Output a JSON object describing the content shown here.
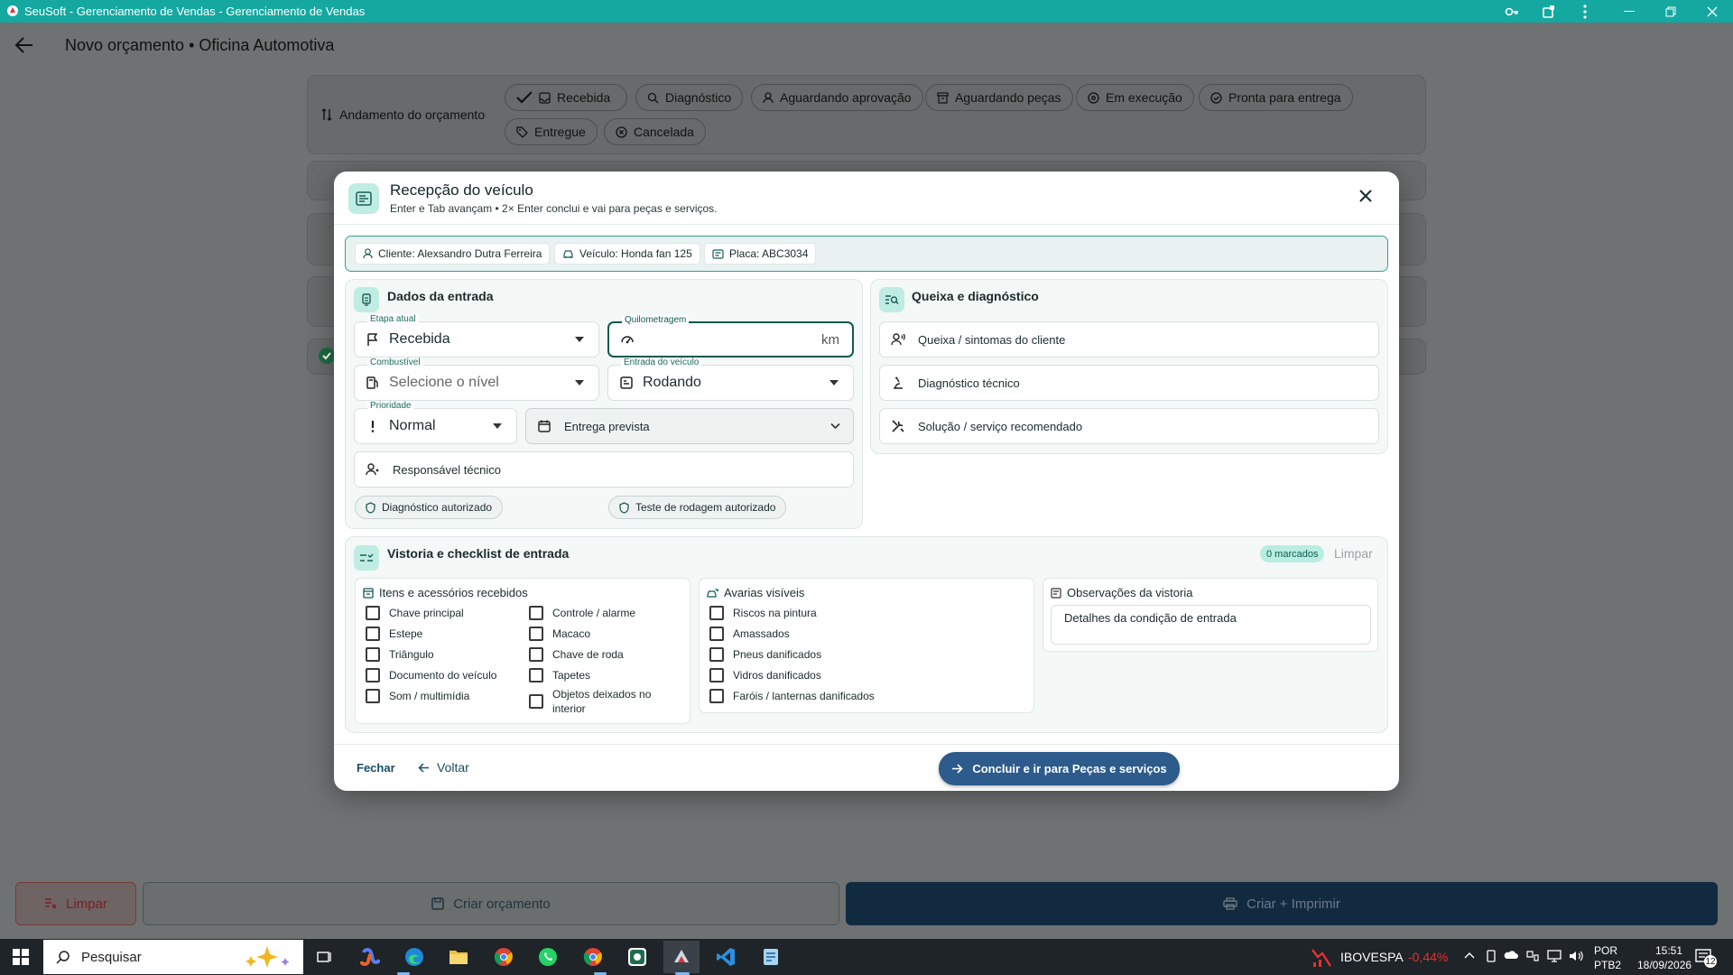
{
  "window": {
    "title": "SeuSoft - Gerenciamento de Vendas - Gerenciamento de Vendas",
    "icons": [
      "app-icon",
      "key-icon",
      "extension-icon",
      "more-vert-icon",
      "minimize-icon",
      "restore-icon",
      "close-icon"
    ]
  },
  "page": {
    "title": "Novo orçamento • Oficina Automotiva",
    "progress_label": "Andamento do orçamento",
    "stages": [
      {
        "label": "Recebida",
        "icon": "inbox-icon",
        "active": true
      },
      {
        "label": "Diagnóstico",
        "icon": "search-icon"
      },
      {
        "label": "Aguardando aprovação",
        "icon": "person-icon"
      },
      {
        "label": "Aguardando peças",
        "icon": "box-icon"
      },
      {
        "label": "Em execução",
        "icon": "gear-icon"
      },
      {
        "label": "Pronta para entrega",
        "icon": "check-circle-icon"
      },
      {
        "label": "Entregue",
        "icon": "tag-icon"
      },
      {
        "label": "Cancelada",
        "icon": "cancel-icon"
      }
    ]
  },
  "bottom": {
    "clear_label": "Limpar",
    "create_label": "Criar orçamento",
    "create_print_label": "Criar + Imprimir"
  },
  "modal": {
    "title": "Recepção do veículo",
    "subtitle": "Enter e Tab avançam • 2× Enter conclui e vai para peças e serviços.",
    "info": {
      "client": "Cliente: Alexsandro Dutra Ferreira",
      "vehicle": "Veículo: Honda fan 125",
      "plate": "Placa: ABC3034"
    },
    "entry": {
      "title": "Dados da entrada",
      "stage_label": "Etapa atual",
      "stage_value": "Recebida",
      "km_label": "Quilometragem",
      "km_value": "",
      "km_suffix": "km",
      "fuel_label": "Combustível",
      "fuel_placeholder": "Selecione o nível",
      "vehicle_entry_label": "Entrada do veículo",
      "vehicle_entry_value": "Rodando",
      "priority_label": "Prioridade",
      "priority_value": "Normal",
      "delivery_label": "Entrega prevista",
      "tech_placeholder": "Responsável técnico",
      "diag_auth": "Diagnóstico autorizado",
      "road_test_auth": "Teste de rodagem autorizado"
    },
    "complaint": {
      "title": "Queixa e diagnóstico",
      "symptoms": "Queixa / sintomas do cliente",
      "diagnosis": "Diagnóstico técnico",
      "solution": "Solução / serviço recomendado"
    },
    "checklist": {
      "title": "Vistoria e checklist de entrada",
      "count_badge": "0 marcados",
      "clear": "Limpar",
      "items_title": "Itens e acessórios recebidos",
      "items_col1": [
        "Chave principal",
        "Estepe",
        "Triângulo",
        "Documento do veículo",
        "Som / multimídia"
      ],
      "items_col2": [
        "Controle / alarme",
        "Macaco",
        "Chave de roda",
        "Tapetes",
        "Objetos deixados no interior"
      ],
      "damage_title": "Avarias visíveis",
      "damages": [
        "Riscos na pintura",
        "Amassados",
        "Pneus danificados",
        "Vidros danificados",
        "Faróis / lanternas danificados"
      ],
      "notes_title": "Observações da vistoria",
      "notes_placeholder": "Detalhes da condição de entrada"
    },
    "footer": {
      "close": "Fechar",
      "back": "Voltar",
      "finish": "Concluir e ir para Peças e serviços"
    }
  },
  "taskbar": {
    "search_placeholder": "Pesquisar",
    "ticker_name": "IBOVESPA",
    "ticker_value": "-0,44%",
    "lang": "POR",
    "layout": "PTB2",
    "time": "15:51",
    "date": "18/09/2026",
    "notifications": "12",
    "colors": {
      "accent": "#14a8a0",
      "primary": "#2c5b8c",
      "danger": "#e0332f"
    }
  }
}
